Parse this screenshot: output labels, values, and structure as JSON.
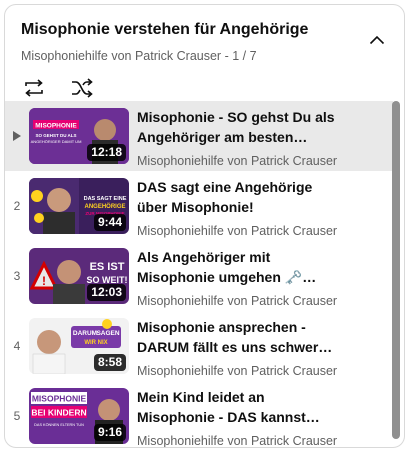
{
  "playlist": {
    "title": "Misophonie verstehen für Angehörige",
    "owner": "Misophoniehilfe von Patrick Crauser",
    "position": "1 / 7",
    "separator": " - ",
    "controls": {
      "loop_icon": "loop-icon",
      "shuffle_icon": "shuffle-icon",
      "collapse_icon": "chevron-up-icon"
    }
  },
  "items": [
    {
      "index": "▶",
      "active": true,
      "title": "Misophonie - SO gehst Du als Angehöriger am besten damit…",
      "channel": "Misophoniehilfe von Patrick Crauser",
      "duration": "12:18",
      "thumb_text": [
        "MISOPHONIE",
        "SO GEHST DU ALS",
        "ANGEHÖRIGER DAMIT UM"
      ]
    },
    {
      "index": "2",
      "active": false,
      "title": "DAS sagt eine Angehörige über Misophonie!",
      "channel": "Misophoniehilfe von Patrick Crauser",
      "duration": "9:44",
      "thumb_text": [
        "DAS SAGT EINE",
        "ANGEHÖRIGE",
        "ZUR MISOPHONIE"
      ]
    },
    {
      "index": "3",
      "active": false,
      "title": "Als Angehöriger mit Misophonie umgehen 🗝️ und…",
      "channel": "Misophoniehilfe von Patrick Crauser",
      "duration": "12:03",
      "thumb_text": [
        "ES IST",
        "SO WEIT!"
      ]
    },
    {
      "index": "4",
      "active": false,
      "title": "Misophonie ansprechen - DARUM fällt es uns schwer…",
      "channel": "Misophoniehilfe von Patrick Crauser",
      "duration": "8:58",
      "thumb_text": [
        "DARUM",
        "SAGEN",
        "WIR NIX"
      ]
    },
    {
      "index": "5",
      "active": false,
      "title": "Mein Kind leidet an Misophonie - DAS kannst du…",
      "channel": "Misophoniehilfe von Patrick Crauser",
      "duration": "9:16",
      "thumb_text": [
        "MISOPHONIE",
        "BEI KINDERN",
        "DAS KÖNNEN ELTERN TUN"
      ]
    }
  ]
}
